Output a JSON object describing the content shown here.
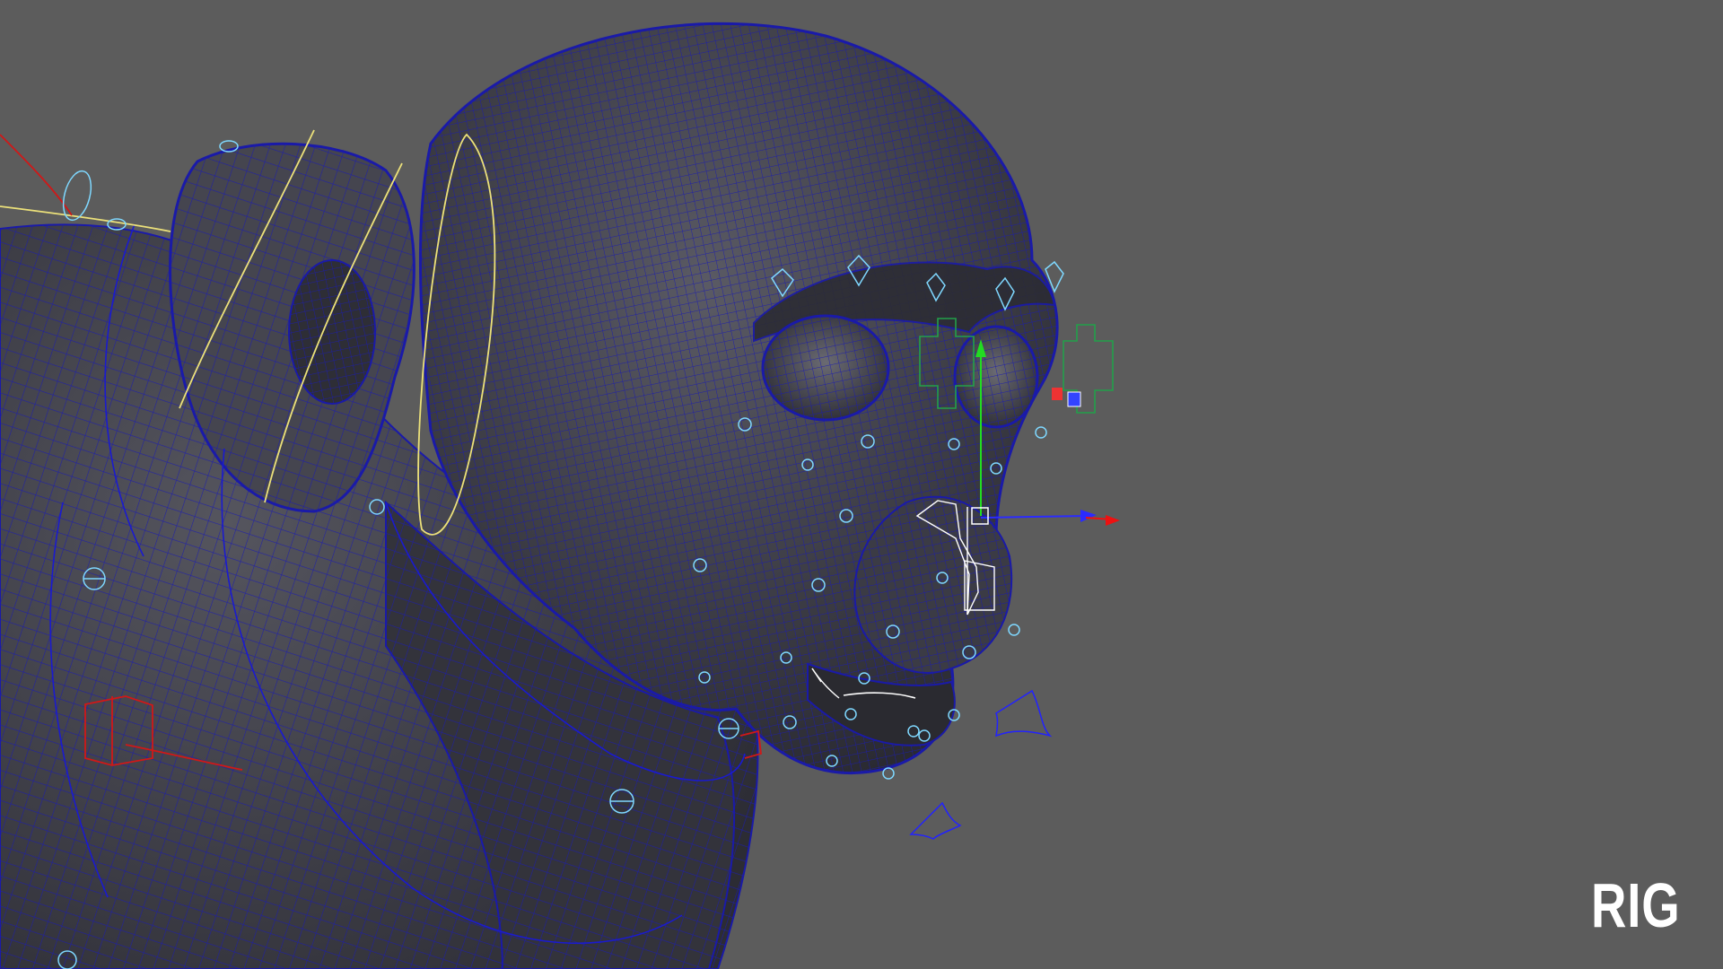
{
  "viewport": {
    "shot_label": "RIG",
    "background_color": "#5c5c5c",
    "mesh_color": "#3c3c44",
    "wireframe_color": "#1a1aa8",
    "face_control_color": "#7fd8ff",
    "ik_curve_color": "#ece17a",
    "eye_control_color": "#22a04a",
    "spine_control_color": "#d01818"
  },
  "manipulator": {
    "axes": [
      "x-axis-red",
      "y-axis-green",
      "z-axis-blue"
    ]
  }
}
